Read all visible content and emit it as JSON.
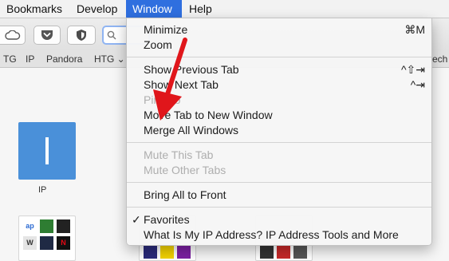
{
  "menubar": {
    "items": [
      "Bookmarks",
      "Develop",
      "Window",
      "Help"
    ],
    "active": "Window"
  },
  "bookmarks_bar": {
    "items": [
      "TG",
      "IP",
      "Pandora",
      "HTG ⌄",
      "ech"
    ]
  },
  "favorites": {
    "tile_label": "IP",
    "tile_glyph": "I",
    "tile_color": "#4a90d9"
  },
  "window_menu": {
    "items": [
      {
        "label": "Minimize",
        "shortcut": "⌘M",
        "enabled": true
      },
      {
        "label": "Zoom",
        "shortcut": "",
        "enabled": true
      },
      {
        "label": "Show Previous Tab",
        "shortcut": "^⇧⇥",
        "enabled": true
      },
      {
        "label": "Show Next Tab",
        "shortcut": "^⇥",
        "enabled": true
      },
      {
        "label": "Pin Tab",
        "shortcut": "",
        "enabled": false
      },
      {
        "label": "Move Tab to New Window",
        "shortcut": "",
        "enabled": true
      },
      {
        "label": "Merge All Windows",
        "shortcut": "",
        "enabled": true
      },
      {
        "label": "Mute This Tab",
        "shortcut": "",
        "enabled": false
      },
      {
        "label": "Mute Other Tabs",
        "shortcut": "",
        "enabled": false
      },
      {
        "label": "Bring All to Front",
        "shortcut": "",
        "enabled": true
      },
      {
        "label": "Favorites",
        "shortcut": "",
        "enabled": true,
        "checked": true
      },
      {
        "label": "What Is My IP Address? IP Address Tools and More",
        "shortcut": "",
        "enabled": true
      }
    ]
  },
  "colors": {
    "menu_highlight": "#2f6fdf",
    "annotation_arrow": "#e0161b"
  }
}
